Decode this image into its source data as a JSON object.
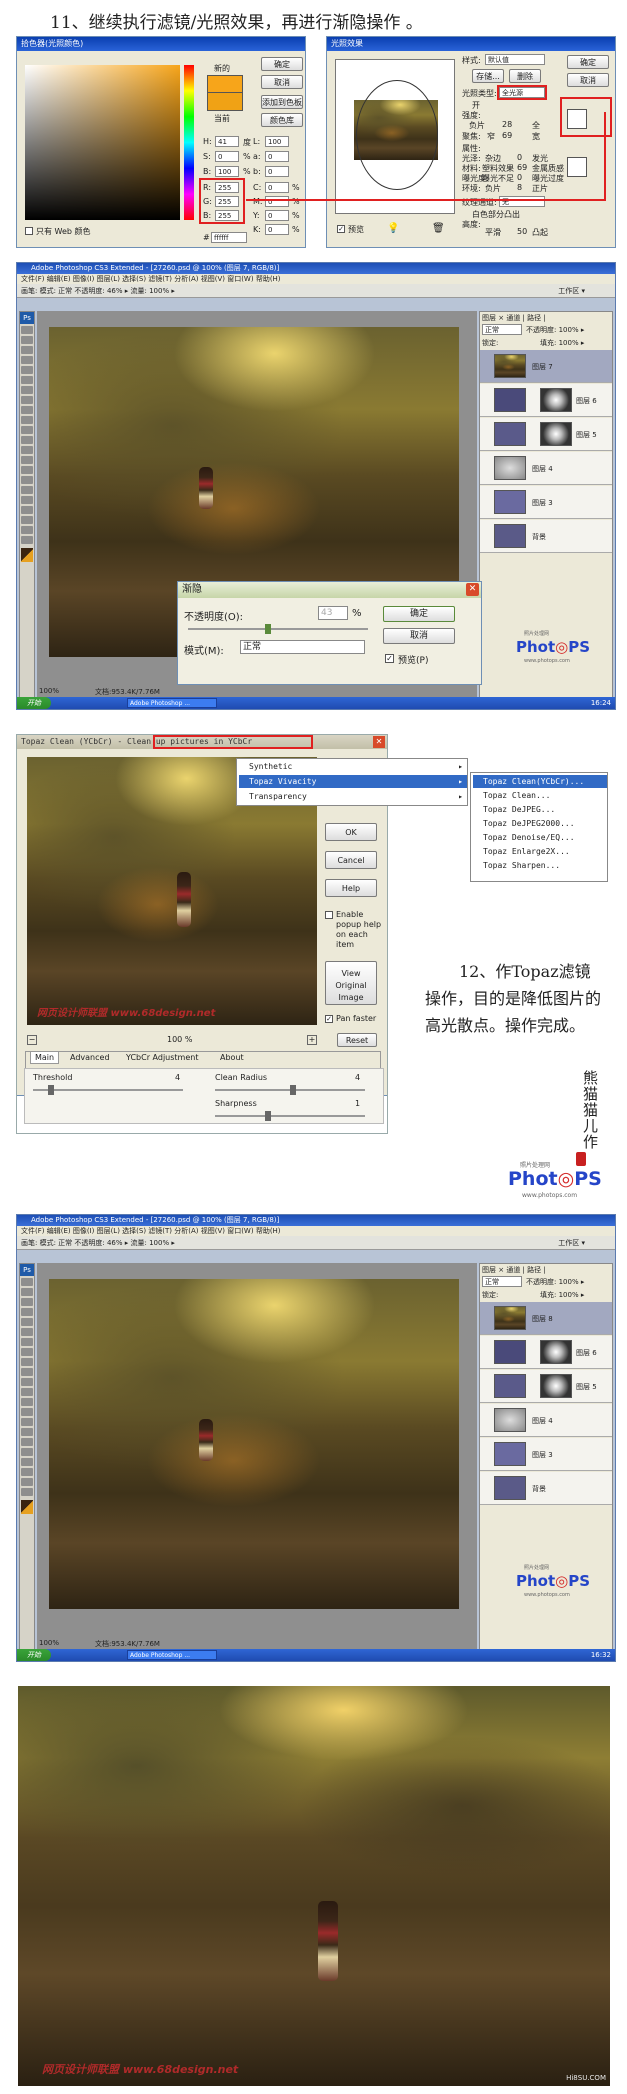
{
  "step11": {
    "title": "11、继续执行滤镜/光照效果，再进行渐隐操作 。"
  },
  "colorpicker": {
    "title": "拾色器(光照颜色)",
    "new_label": "新的",
    "current_label": "当前",
    "ok": "确定",
    "cancel": "取消",
    "add_swatch": "添加到色板",
    "libraries": "颜色库",
    "h_label": "H:",
    "h_value": "41",
    "h_unit": "度",
    "s_label": "S:",
    "s_value": "0",
    "s_unit": "%",
    "b_label": "B:",
    "b_value": "100",
    "b_unit": "%",
    "r_label": "R:",
    "r_value": "255",
    "g_label": "G:",
    "g_value": "255",
    "bb_label": "B:",
    "bb_value": "255",
    "l_label": "L:",
    "l_value": "100",
    "a_label": "a:",
    "a_value": "0",
    "b2_label": "b:",
    "b2_value": "0",
    "c_label": "C:",
    "c_value": "0",
    "c_unit": "%",
    "m_label": "M:",
    "m_value": "0",
    "m_unit": "%",
    "y_label": "Y:",
    "y_value": "0",
    "y_unit": "%",
    "k_label": "K:",
    "k_value": "0",
    "k_unit": "%",
    "hex_label": "#",
    "hex_value": "ffffff",
    "web_only": "只有 Web 颜色",
    "new_color": "#f7a51a",
    "current_color": "#f0a215"
  },
  "lighting": {
    "title": "光照效果",
    "style_label": "样式:",
    "style_value": "默认值",
    "save": "存储...",
    "delete": "删除",
    "type_label": "光照类型:",
    "type_value": "全光源",
    "on_label": "开",
    "intensity_label": "强度:",
    "intensity_neg": "负片",
    "intensity_value": "28",
    "intensity_pos": "全",
    "focus_label": "聚焦:",
    "focus_narrow": "窄",
    "focus_value": "69",
    "focus_wide": "宽",
    "properties_label": "属性:",
    "gloss_label": "光泽:",
    "gloss_min": "杂边",
    "gloss_value": "0",
    "gloss_max": "发光",
    "material_label": "材料:",
    "material_min": "塑料效果",
    "material_value": "69",
    "material_max": "金属质感",
    "exposure_label": "曝光度:",
    "exposure_min": "曝光不足",
    "exposure_value": "0",
    "exposure_max": "曝光过度",
    "ambience_label": "环境:",
    "ambience_min": "负片",
    "ambience_value": "8",
    "ambience_max": "正片",
    "texture_label": "纹理通道:",
    "texture_value": "无",
    "white_high": "白色部分凸出",
    "height_label": "高度:",
    "height_flat": "平滑",
    "height_value": "50",
    "height_mountain": "凸起",
    "ok": "确定",
    "cancel": "取消",
    "preview": "预览"
  },
  "ps1": {
    "title": "Adobe Photoshop CS3 Extended - [27260.psd @ 100% (图层 7, RGB/8)]",
    "menu": "文件(F)  编辑(E)  图像(I)  图层(L)  选择(S)  滤镜(T)  分析(A)  视图(V)  窗口(W)  帮助(H)",
    "opts": "画笔:  模式: 正常   不透明度: 46% ▸  流量: 100% ▸",
    "workspace": "工作区 ▾",
    "zoom": "100%",
    "doc": "文档:953.4K/7.76M",
    "layers_tabs": "图层 × 通道 | 路径 |",
    "blend": "正常",
    "opacity": "不透明度: 100% ▸",
    "lock": "锁定:",
    "fill": "填充: 100% ▸",
    "layers": [
      "图层 7",
      "图层 6",
      "图层 5",
      "图层 4",
      "图层 3",
      "背景"
    ],
    "time": "16:24"
  },
  "fade": {
    "title": "渐隐",
    "opacity_label": "不透明度(O):",
    "opacity_value": "43",
    "opacity_unit": "%",
    "mode_label": "模式(M):",
    "mode_value": "正常",
    "ok": "确定",
    "cancel": "取消",
    "preview": "预览(P)"
  },
  "topaz": {
    "title": "Topaz Clean (YCbCr) - Clean up pictures in YCbCr",
    "ok": "OK",
    "cancel": "Cancel",
    "help": "Help",
    "enable_popup": "Enable popup help on each item",
    "view_original": "View Original Image",
    "pan_faster": "Pan faster",
    "reset": "Reset",
    "zoom": "100 %",
    "tabs": [
      "Main",
      "Advanced",
      "YCbCr Adjustment",
      "About"
    ],
    "threshold_label": "Threshold",
    "threshold_value": "4",
    "clean_radius_label": "Clean Radius",
    "clean_radius_value": "4",
    "sharpness_label": "Sharpness",
    "sharpness_value": "1",
    "watermark": "网页设计师联盟 www.68design.net"
  },
  "menu": {
    "items": [
      "Synthetic",
      "Topaz Vivacity",
      "Transparency"
    ],
    "submenu": [
      "Topaz Clean(YCbCr)...",
      "Topaz Clean...",
      "Topaz DeJPEG...",
      "Topaz DeJPEG2000...",
      "Topaz Denoise/EQ...",
      "Topaz Enlarge2X...",
      "Topaz Sharpen..."
    ]
  },
  "step12": {
    "text": "12、作Topaz滤镜操作，目的是降低图片的高光散点。操作完成。"
  },
  "signature": "熊猫猫儿作",
  "logo": {
    "site_cn": "照片处理网",
    "brand_a": "Phot",
    "brand_b": "◎",
    "brand_c": "PS",
    "site_url": "www.photops.com"
  },
  "ps2": {
    "title": "Adobe Photoshop CS3 Extended - [27260.psd @ 100% (图层 7, RGB/8)]",
    "menu": "文件(F)  编辑(E)  图像(I)  图层(L)  选择(S)  滤镜(T)  分析(A)  视图(V)  窗口(W)  帮助(H)",
    "opts": "画笔:  模式: 正常   不透明度: 46% ▸  流量: 100% ▸",
    "workspace": "工作区 ▾",
    "zoom": "100%",
    "doc": "文档:953.4K/7.76M",
    "layers_tabs": "图层 × 通道 | 路径 |",
    "blend": "正常",
    "opacity": "不透明度: 100% ▸",
    "lock": "锁定:",
    "fill": "填充: 100% ▸",
    "layers": [
      "图层 8",
      "图层 6",
      "图层 5",
      "图层 4",
      "图层 3",
      "背景"
    ],
    "time": "16:32"
  },
  "final": {
    "watermark": "网页设计师联盟 www.68design.net",
    "corner_logo": "Hi8SU.COM"
  },
  "taskbar": {
    "start": "开始",
    "app": "Adobe Photoshop ..."
  }
}
